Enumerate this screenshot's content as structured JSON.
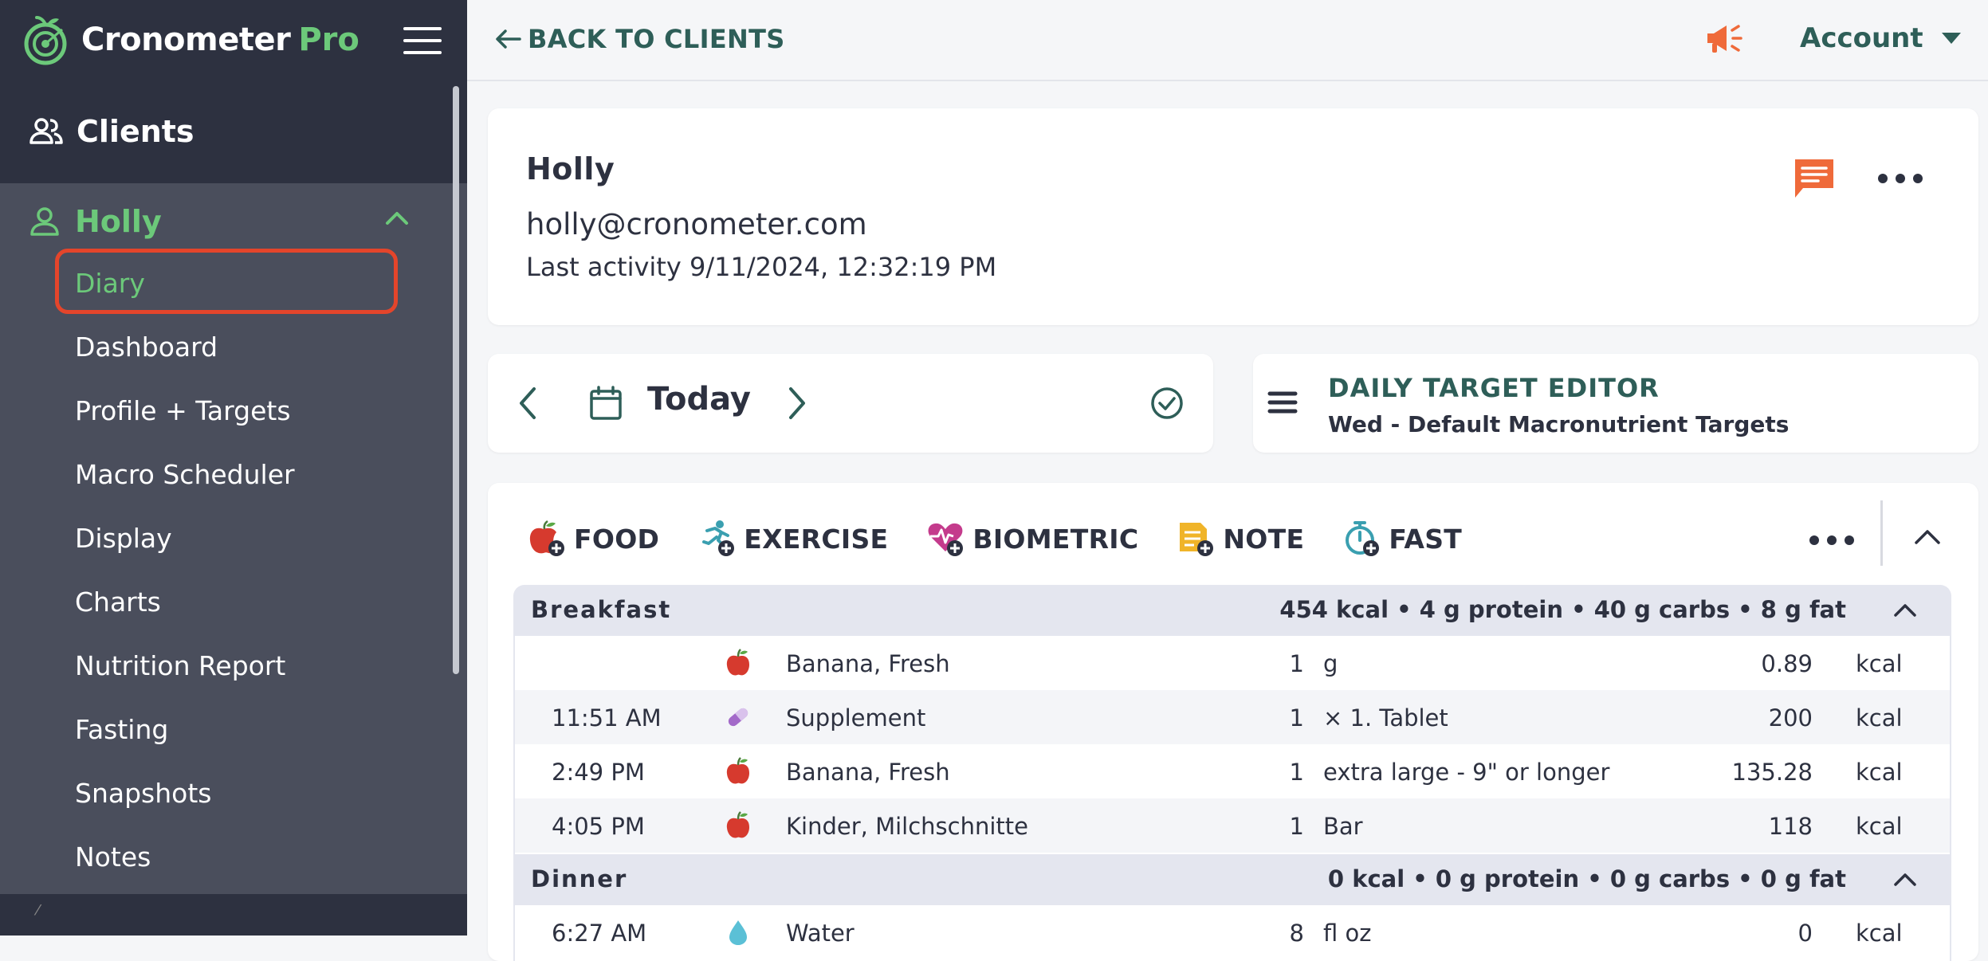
{
  "app": {
    "logo_text": "Cronometer",
    "logo_suffix": "Pro",
    "accent_color": "#6cc97a",
    "dark_color": "#2d3140",
    "teal_color": "#2e5e58"
  },
  "sidebar": {
    "clients_label": "Clients",
    "client_name": "Holly",
    "items": [
      {
        "label": "Diary",
        "active": true
      },
      {
        "label": "Dashboard"
      },
      {
        "label": "Profile + Targets"
      },
      {
        "label": "Macro Scheduler"
      },
      {
        "label": "Display"
      },
      {
        "label": "Charts"
      },
      {
        "label": "Nutrition Report"
      },
      {
        "label": "Fasting"
      },
      {
        "label": "Snapshots"
      },
      {
        "label": "Notes"
      }
    ]
  },
  "topbar": {
    "back_label": "BACK TO CLIENTS",
    "account_label": "Account"
  },
  "client": {
    "name": "Holly",
    "email": "holly@cronometer.com",
    "last_activity": "Last activity 9/11/2024, 12:32:19 PM"
  },
  "date_nav": {
    "label": "Today"
  },
  "target_editor": {
    "title": "DAILY TARGET EDITOR",
    "subtitle": "Wed - Default Macronutrient Targets"
  },
  "add_buttons": [
    {
      "label": "FOOD",
      "icon": "apple-plus-icon"
    },
    {
      "label": "EXERCISE",
      "icon": "runner-plus-icon"
    },
    {
      "label": "BIOMETRIC",
      "icon": "heart-pulse-plus-icon"
    },
    {
      "label": "NOTE",
      "icon": "note-plus-icon"
    },
    {
      "label": "FAST",
      "icon": "stopwatch-plus-icon"
    }
  ],
  "meals": [
    {
      "name": "Breakfast",
      "summary": "454 kcal • 4 g protein • 40 g carbs • 8 g fat",
      "entries": [
        {
          "time": "",
          "icon": "apple-icon",
          "name": "Banana, Fresh",
          "qty": "1",
          "unit": "g",
          "value": "0.89",
          "kcal": "kcal"
        },
        {
          "time": "11:51 AM",
          "icon": "pill-icon",
          "name": "Supplement",
          "qty": "1",
          "unit": "× 1. Tablet",
          "value": "200",
          "kcal": "kcal"
        },
        {
          "time": "2:49 PM",
          "icon": "apple-icon",
          "name": "Banana, Fresh",
          "qty": "1",
          "unit": "extra large - 9\" or longer",
          "value": "135.28",
          "kcal": "kcal"
        },
        {
          "time": "4:05 PM",
          "icon": "apple-icon",
          "name": "Kinder, Milchschnitte",
          "qty": "1",
          "unit": "Bar",
          "value": "118",
          "kcal": "kcal"
        }
      ]
    },
    {
      "name": "Dinner",
      "summary": "0 kcal • 0 g protein • 0 g carbs • 0 g fat",
      "entries": [
        {
          "time": "6:27 AM",
          "icon": "water-drop-icon",
          "name": "Water",
          "qty": "8",
          "unit": "fl oz",
          "value": "0",
          "kcal": "kcal"
        }
      ]
    }
  ]
}
